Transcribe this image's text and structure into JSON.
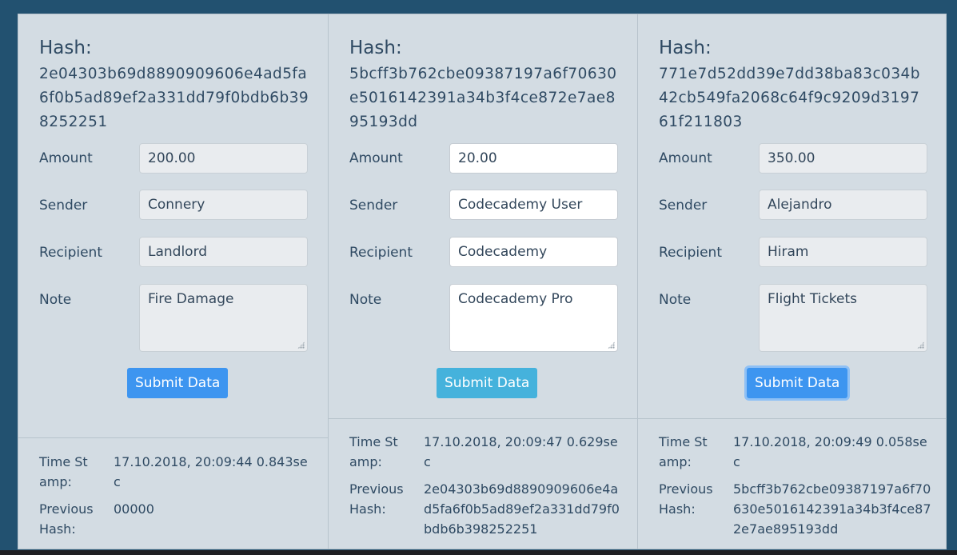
{
  "blocks": [
    {
      "hash_label": "Hash:",
      "hash": "2e04303b69d8890909606e4ad5fa6f0b5ad89ef2a331dd79f0bdb6b398252251",
      "amount_label": "Amount",
      "amount": "200.00",
      "sender_label": "Sender",
      "sender": "Connery",
      "recipient_label": "Recipient",
      "recipient": "Landlord",
      "note_label": "Note",
      "note": "Fire Damage",
      "submit_label": "Submit Data",
      "timestamp_label": "Time Stamp:",
      "timestamp": "17.10.2018, 20:09:44 0.843sec",
      "prev_hash_label": "Previous Hash:",
      "prev_hash": "00000"
    },
    {
      "hash_label": "Hash:",
      "hash": "5bcff3b762cbe09387197a6f70630e5016142391a34b3f4ce872e7ae895193dd",
      "amount_label": "Amount",
      "amount": "20.00",
      "sender_label": "Sender",
      "sender": "Codecademy User",
      "recipient_label": "Recipient",
      "recipient": "Codecademy",
      "note_label": "Note",
      "note": "Codecademy Pro",
      "submit_label": "Submit Data",
      "timestamp_label": "Time Stamp:",
      "timestamp": "17.10.2018, 20:09:47 0.629sec",
      "prev_hash_label": "Previous Hash:",
      "prev_hash": "2e04303b69d8890909606e4ad5fa6f0b5ad89ef2a331dd79f0bdb6b398252251"
    },
    {
      "hash_label": "Hash:",
      "hash": "771e7d52dd39e7dd38ba83c034b42cb549fa2068c64f9c9209d319761f211803",
      "amount_label": "Amount",
      "amount": "350.00",
      "sender_label": "Sender",
      "sender": "Alejandro",
      "recipient_label": "Recipient",
      "recipient": "Hiram",
      "note_label": "Note",
      "note": "Flight Tickets",
      "submit_label": "Submit Data",
      "timestamp_label": "Time Stamp:",
      "timestamp": "17.10.2018, 20:09:49 0.058sec",
      "prev_hash_label": "Previous Hash:",
      "prev_hash": "5bcff3b762cbe09387197a6f70630e5016142391a34b3f4ce872e7ae895193dd"
    }
  ],
  "colors": {
    "page_background": "#225170",
    "panel_background": "#d3dce3",
    "text": "#2f4a63",
    "button_blue": "#3d95f0",
    "button_teal": "#45b2dc"
  }
}
